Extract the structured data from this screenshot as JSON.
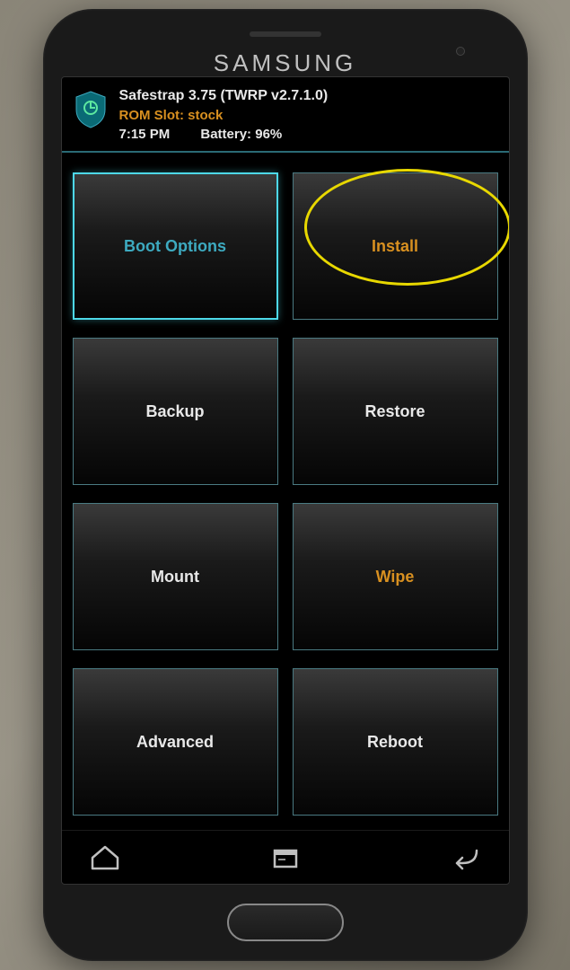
{
  "brand": "SAMSUNG",
  "header": {
    "title": "Safestrap 3.75 (TWRP v2.7.1.0)",
    "rom_slot": "ROM Slot: stock",
    "time": "7:15 PM",
    "battery": "Battery: 96%"
  },
  "tiles": {
    "boot_options": "Boot Options",
    "install": "Install",
    "backup": "Backup",
    "restore": "Restore",
    "mount": "Mount",
    "wipe": "Wipe",
    "advanced": "Advanced",
    "reboot": "Reboot"
  }
}
